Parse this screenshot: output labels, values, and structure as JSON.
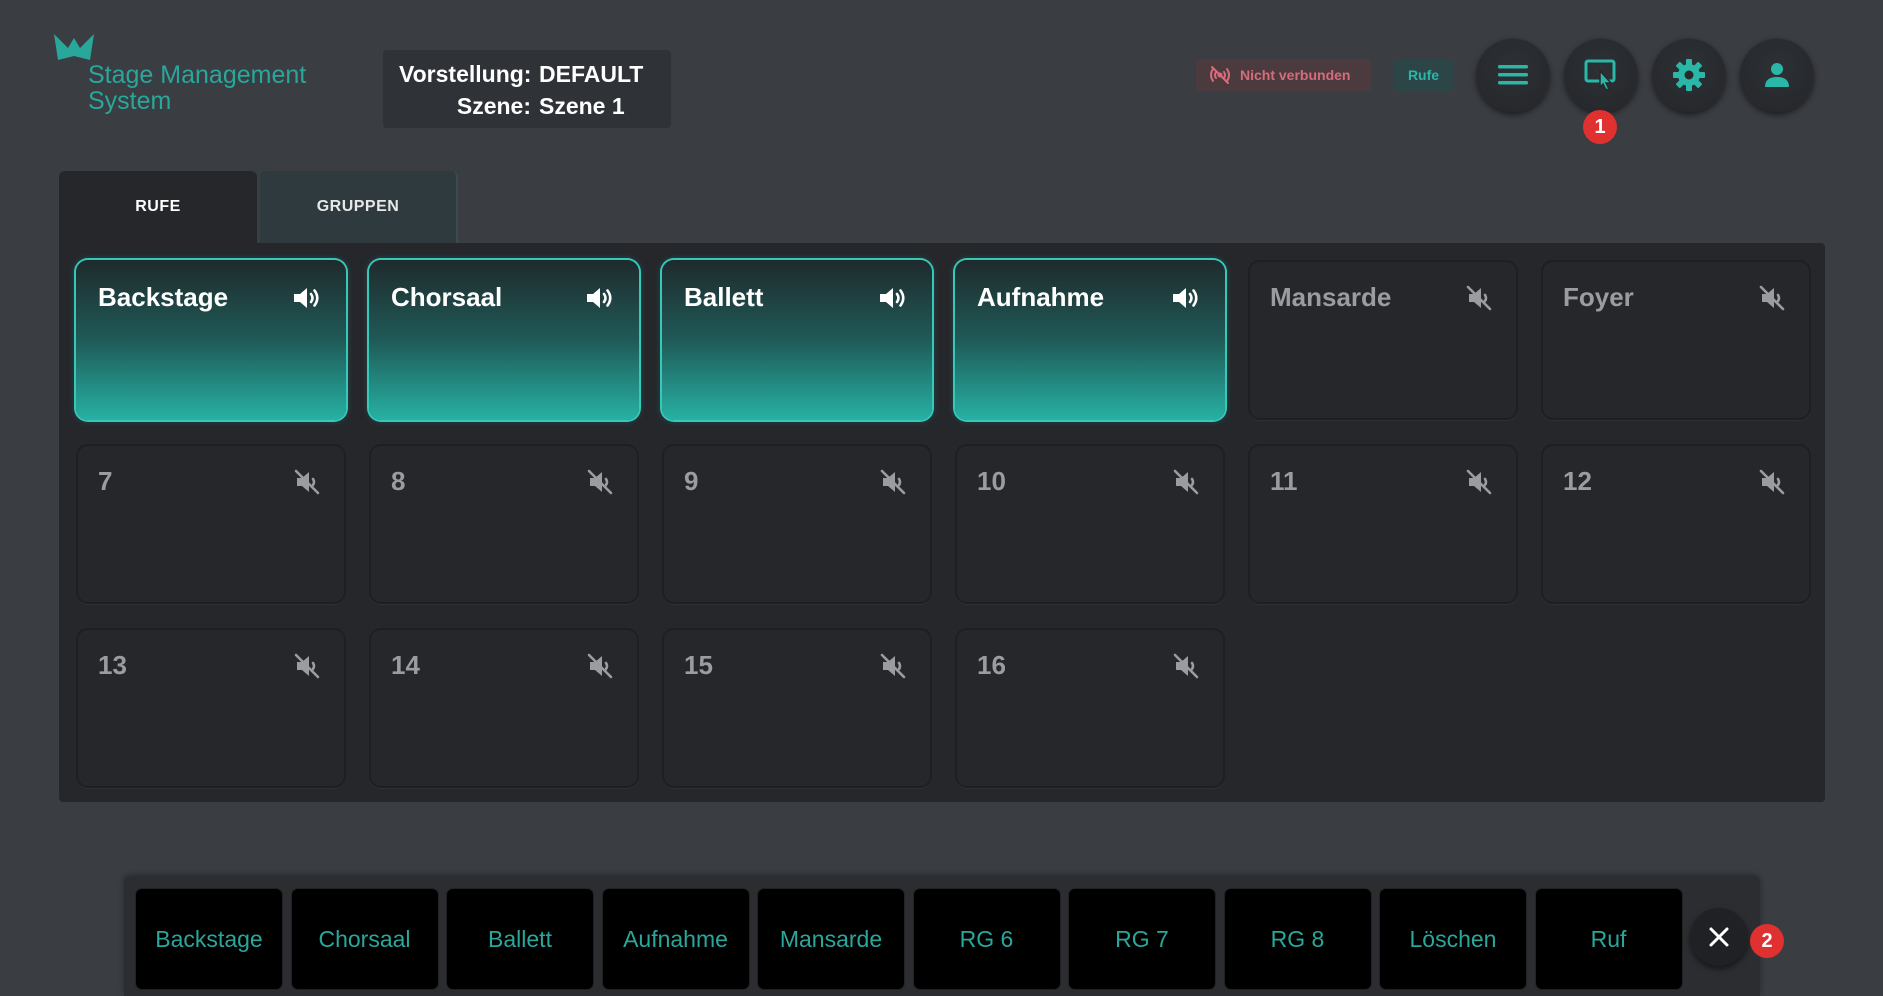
{
  "header": {
    "logo_text_line1": "Stage Management",
    "logo_text_line2": "System",
    "performance_label": "Vorstellung:",
    "performance_value": "DEFAULT",
    "scene_label": "Szene:",
    "scene_value": "Szene 1",
    "connection_status": "Nicht verbunden",
    "mode_badge": "Rufe",
    "notification_1": "1",
    "notification_2": "2"
  },
  "tabs": [
    {
      "label": "RUFE",
      "active": true
    },
    {
      "label": "GRUPPEN",
      "active": false
    }
  ],
  "tiles": [
    {
      "label": "Backstage",
      "active": true
    },
    {
      "label": "Chorsaal",
      "active": true
    },
    {
      "label": "Ballett",
      "active": true
    },
    {
      "label": "Aufnahme",
      "active": true
    },
    {
      "label": "Mansarde",
      "active": false
    },
    {
      "label": "Foyer",
      "active": false
    },
    {
      "label": "7",
      "active": false
    },
    {
      "label": "8",
      "active": false
    },
    {
      "label": "9",
      "active": false
    },
    {
      "label": "10",
      "active": false
    },
    {
      "label": "11",
      "active": false
    },
    {
      "label": "12",
      "active": false
    },
    {
      "label": "13",
      "active": false
    },
    {
      "label": "14",
      "active": false
    },
    {
      "label": "15",
      "active": false
    },
    {
      "label": "16",
      "active": false
    }
  ],
  "bottom_bar": [
    "Backstage",
    "Chorsaal",
    "Ballett",
    "Aufnahme",
    "Mansarde",
    "RG 6",
    "RG 7",
    "RG 8",
    "Löschen",
    "Ruf"
  ],
  "colors": {
    "accent": "#2aa79b",
    "background": "#3a3d42",
    "panel": "#25272b",
    "alert": "#e03030"
  }
}
